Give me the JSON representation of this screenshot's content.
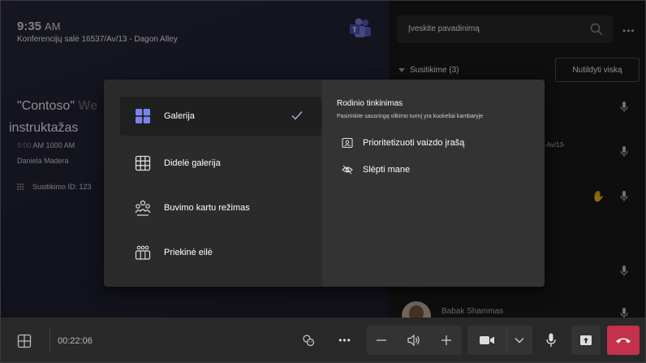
{
  "room": {
    "time": "9:35",
    "ampm": "AM",
    "room_name": "Konferencijų salė 16537/Av/13 - Dagon Alley",
    "meeting_title": "\"Contoso\"",
    "meeting_title_faded": "We",
    "meeting_title_line2": "instruktažas",
    "meeting_time_start": "9:00",
    "meeting_time_rest": "AM 1000 AM",
    "organizer": "Daniela Madera",
    "meeting_id": "Susitikimo ID: 123"
  },
  "side": {
    "search_placeholder": "Įveskite pavadinimą",
    "more": "•••",
    "in_meeting": "Susitikime (3)",
    "mute_all": "Nutildyti viską",
    "participant_fragment": "-Av/13-",
    "participant_name": "Babak Shammas"
  },
  "popup": {
    "options": [
      {
        "label": "Galerija",
        "icon": "gallery-icon",
        "selected": true
      },
      {
        "label": "Didelė galerija",
        "icon": "large-gallery-icon"
      },
      {
        "label": "Buvimo kartu režimas",
        "icon": "together-mode-icon"
      },
      {
        "label": "Priekinė eilė",
        "icon": "front-row-icon"
      }
    ],
    "customize_title": "Rodinio tinkinimas",
    "customize_desc": "Pasirinkite sausringą vilkimo turinį yra kuokeliai kambaryje",
    "prioritize_video": "Prioritetizuoti vaizdo įrašą",
    "hide_me": "Slėpti mane"
  },
  "bottom": {
    "timer": "00:22:06",
    "more": "•••"
  },
  "colors": {
    "accent": "#7b83eb",
    "hangup": "#c4314b",
    "raise_hand": "#e8a33b"
  }
}
